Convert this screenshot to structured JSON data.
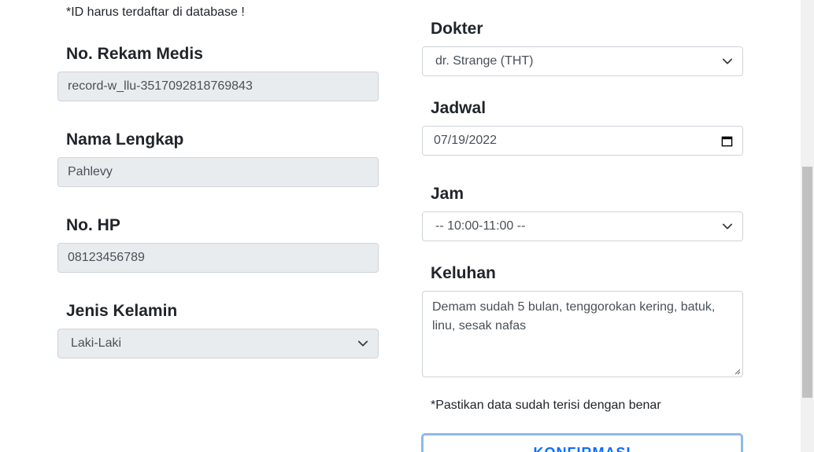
{
  "left": {
    "note": "*ID harus terdaftar di database !",
    "rekam_medis": {
      "label": "No. Rekam Medis",
      "value": "record-w_llu-3517092818769843"
    },
    "nama": {
      "label": "Nama Lengkap",
      "value": "Pahlevy"
    },
    "hp": {
      "label": "No. HP",
      "value": "08123456789"
    },
    "kelamin": {
      "label": "Jenis Kelamin",
      "value": "Laki-Laki"
    }
  },
  "right": {
    "dokter": {
      "label": "Dokter",
      "value": "dr. Strange (THT)"
    },
    "jadwal": {
      "label": "Jadwal",
      "value": "07/19/2022"
    },
    "jam": {
      "label": "Jam",
      "value": "-- 10:00-11:00 --"
    },
    "keluhan": {
      "label": "Keluhan",
      "value": "Demam sudah 5 bulan, tenggorokan kering, batuk, linu, sesak nafas"
    },
    "confirm_note": "*Pastikan data sudah terisi dengan benar",
    "confirm_button": "KONFIRMASI"
  },
  "colors": {
    "readonly_bg": "#e9ecef",
    "border": "#ced4da",
    "button_text": "#0d6efd",
    "button_border": "#8fb9ea"
  },
  "icons": {
    "select_arrow": "chevron-down-icon",
    "date_picker": "calendar-icon"
  }
}
